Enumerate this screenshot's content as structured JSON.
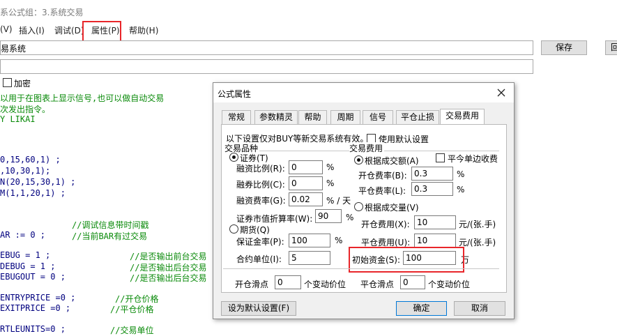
{
  "window": {
    "title": "系公式组：3.系统交易",
    "menu": [
      "(V)",
      "插入(I)",
      "调试(D)",
      "属性(P)",
      "帮助(H)"
    ],
    "formula_name": "易系统",
    "save_label": "保存",
    "edge_button_label": "回",
    "encrypt_label": "加密"
  },
  "code": {
    "lines": [
      {
        "text": "以用于在图表上显示信号,也可以做自动交易",
        "color": "green"
      },
      {
        "text": "次发出指令。",
        "color": "green"
      },
      {
        "text": "Y LIKAI",
        "color": "green"
      },
      {
        "text": "0,15,60,1) ;",
        "color": "navy"
      },
      {
        "text": ",10,30,1);",
        "color": "navy"
      },
      {
        "text": "N(20,15,30,1) ;",
        "color": "navy"
      },
      {
        "text": "M(1,1,20,1) ;",
        "color": "navy"
      }
    ],
    "pairs": [
      {
        "code": "",
        "comment": "//调试信息带时间戳"
      },
      {
        "code": "AR := 0 ;",
        "comment": "//当前BAR有过交易"
      },
      {
        "code": "EBUG = 1 ;",
        "comment": "//是否输出前台交易"
      },
      {
        "code": "DEBUG = 1 ;",
        "comment": "//是否输出后台交易"
      },
      {
        "code": "EBUGOUT = 0 ;",
        "comment": "//是否输出后台交易"
      },
      {
        "code": "ENTRYPRICE =0 ;",
        "comment": "//开仓价格"
      },
      {
        "code": "EXITPRICE =0 ;",
        "comment": "//平仓价格"
      },
      {
        "code": "RTLEUNITS=0 ;",
        "comment": "//交易单位"
      }
    ]
  },
  "dialog": {
    "title": "公式属性",
    "close_icon": "close-icon",
    "tabs": [
      "常规",
      "参数精灵",
      "帮助",
      "周期",
      "信号",
      "平仓止损",
      "交易费用"
    ],
    "active_tab": "交易费用",
    "notice": "以下设置仅对BUY等新交易系统有效。",
    "use_default_label": "使用默认设置",
    "left": {
      "group_title": "交易品种",
      "securities_label": "证券(T)",
      "margin_ratio_label": "融资比例(R):",
      "margin_ratio_value": "0",
      "short_ratio_label": "融券比例(C):",
      "short_ratio_value": "0",
      "financing_rate_label": "融资费率(G):",
      "financing_rate_value": "0.02",
      "pct": "%",
      "per_day": "% / 天",
      "discount_label": "证券市值折算率(W):",
      "discount_value": "90",
      "futures_label": "期货(Q)",
      "deposit_rate_label": "保证金率(P):",
      "deposit_rate_value": "100",
      "contract_unit_label": "合约单位(I):",
      "contract_unit_value": "5"
    },
    "right": {
      "group_title": "交易费用",
      "by_amount_label": "根据成交额(A)",
      "close_single_label": "平今单边收费",
      "open_rate_label": "开仓费率(B):",
      "open_rate_value": "0.3",
      "close_rate_label": "平仓费率(L):",
      "close_rate_value": "0.3",
      "by_volume_label": "根据成交量(V)",
      "open_fee_label": "开仓费用(X):",
      "open_fee_value": "10",
      "close_fee_label": "平仓费用(U):",
      "close_fee_value": "10",
      "fee_unit": "元/(张.手)",
      "capital_label": "初始资金(S):",
      "capital_value": "100",
      "capital_unit": "万"
    },
    "slippage": {
      "open_label": "开仓滑点",
      "open_value": "0",
      "close_label": "平仓滑点",
      "close_value": "0",
      "unit": "个变动价位"
    },
    "buttons": {
      "set_default": "设为默认设置(F)",
      "ok": "确定",
      "cancel": "取消"
    }
  }
}
